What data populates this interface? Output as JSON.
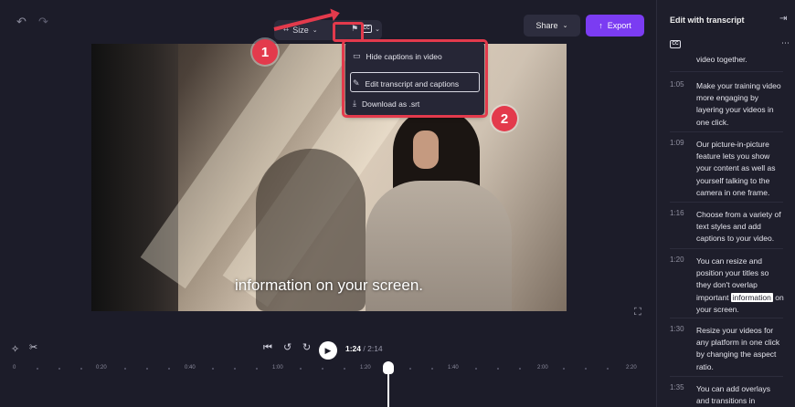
{
  "toolbar": {
    "undo_icon": "undo-icon",
    "redo_icon": "redo-icon",
    "size_label": "Size",
    "share_label": "Share",
    "export_label": "Export",
    "export_color": "#7b3cf2"
  },
  "caption_menu": {
    "items": [
      {
        "icon": "captions-icon",
        "label": "Hide captions in video"
      },
      {
        "icon": "edit-transcript-icon",
        "label": "Edit transcript and captions"
      },
      {
        "icon": "download-icon",
        "label": "Download as .srt"
      }
    ]
  },
  "annotations": {
    "badge1": "1",
    "badge2": "2",
    "color": "#e33a4c"
  },
  "video": {
    "caption_text": "information on your screen."
  },
  "playback": {
    "current_time": "1:24",
    "separator": " / ",
    "total_time": "2:14"
  },
  "timeline": {
    "ticks": [
      "0",
      "0:20",
      "0:40",
      "1:00",
      "1:20",
      "1:40",
      "2:00",
      "2:20"
    ]
  },
  "transcript": {
    "title": "Edit with transcript",
    "partial_text": "video together.",
    "segments": [
      {
        "time": "1:05",
        "text": "Make your training video  more engaging by layering your videos in one click."
      },
      {
        "time": "1:09",
        "text": "Our picture-in-picture feature lets you show your content as well as yourself talking to the camera in one frame."
      },
      {
        "time": "1:16",
        "text": "Choose from a variety of  text styles and add captions to your video."
      },
      {
        "time": "1:20",
        "text_before": "You can resize and position your titles so they don't overlap important ",
        "highlight": "information",
        "text_after": " on your screen."
      },
      {
        "time": "1:30",
        "text": "Resize your videos for any platform in one click  by changing the aspect ratio."
      },
      {
        "time": "1:35",
        "text": "You can add overlays and transitions in"
      }
    ]
  }
}
